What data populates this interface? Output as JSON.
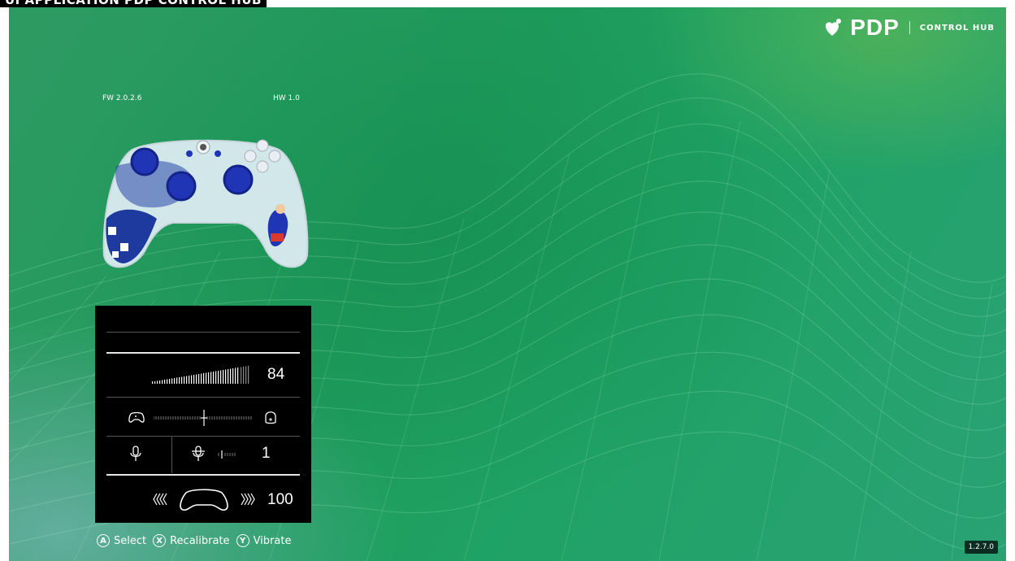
{
  "header": {
    "title": "UI APPLICATION PDP CONTROL HUB"
  },
  "brand": {
    "name": "PDP",
    "product": "CONTROL HUB"
  },
  "device": {
    "firmware": "FW 2.0.2.6",
    "hardware": "HW 1.0"
  },
  "panel": {
    "volume_value": "84",
    "balance_left_icon": "controller-sound-icon",
    "balance_right_icon": "headset-sound-icon",
    "mic_icon": "microphone-icon",
    "mic_monitor_icon": "mic-monitor-icon",
    "mic_monitor_value": "1",
    "vibration_value": "100"
  },
  "hints": [
    {
      "key": "A",
      "label": "Select"
    },
    {
      "key": "X",
      "label": "Recalibrate"
    },
    {
      "key": "Y",
      "label": "Vibrate"
    }
  ],
  "version": "1.2.7.0",
  "colors": {
    "background_green": "#1e9b5a",
    "panel": "#000000",
    "text": "#ffffff"
  }
}
